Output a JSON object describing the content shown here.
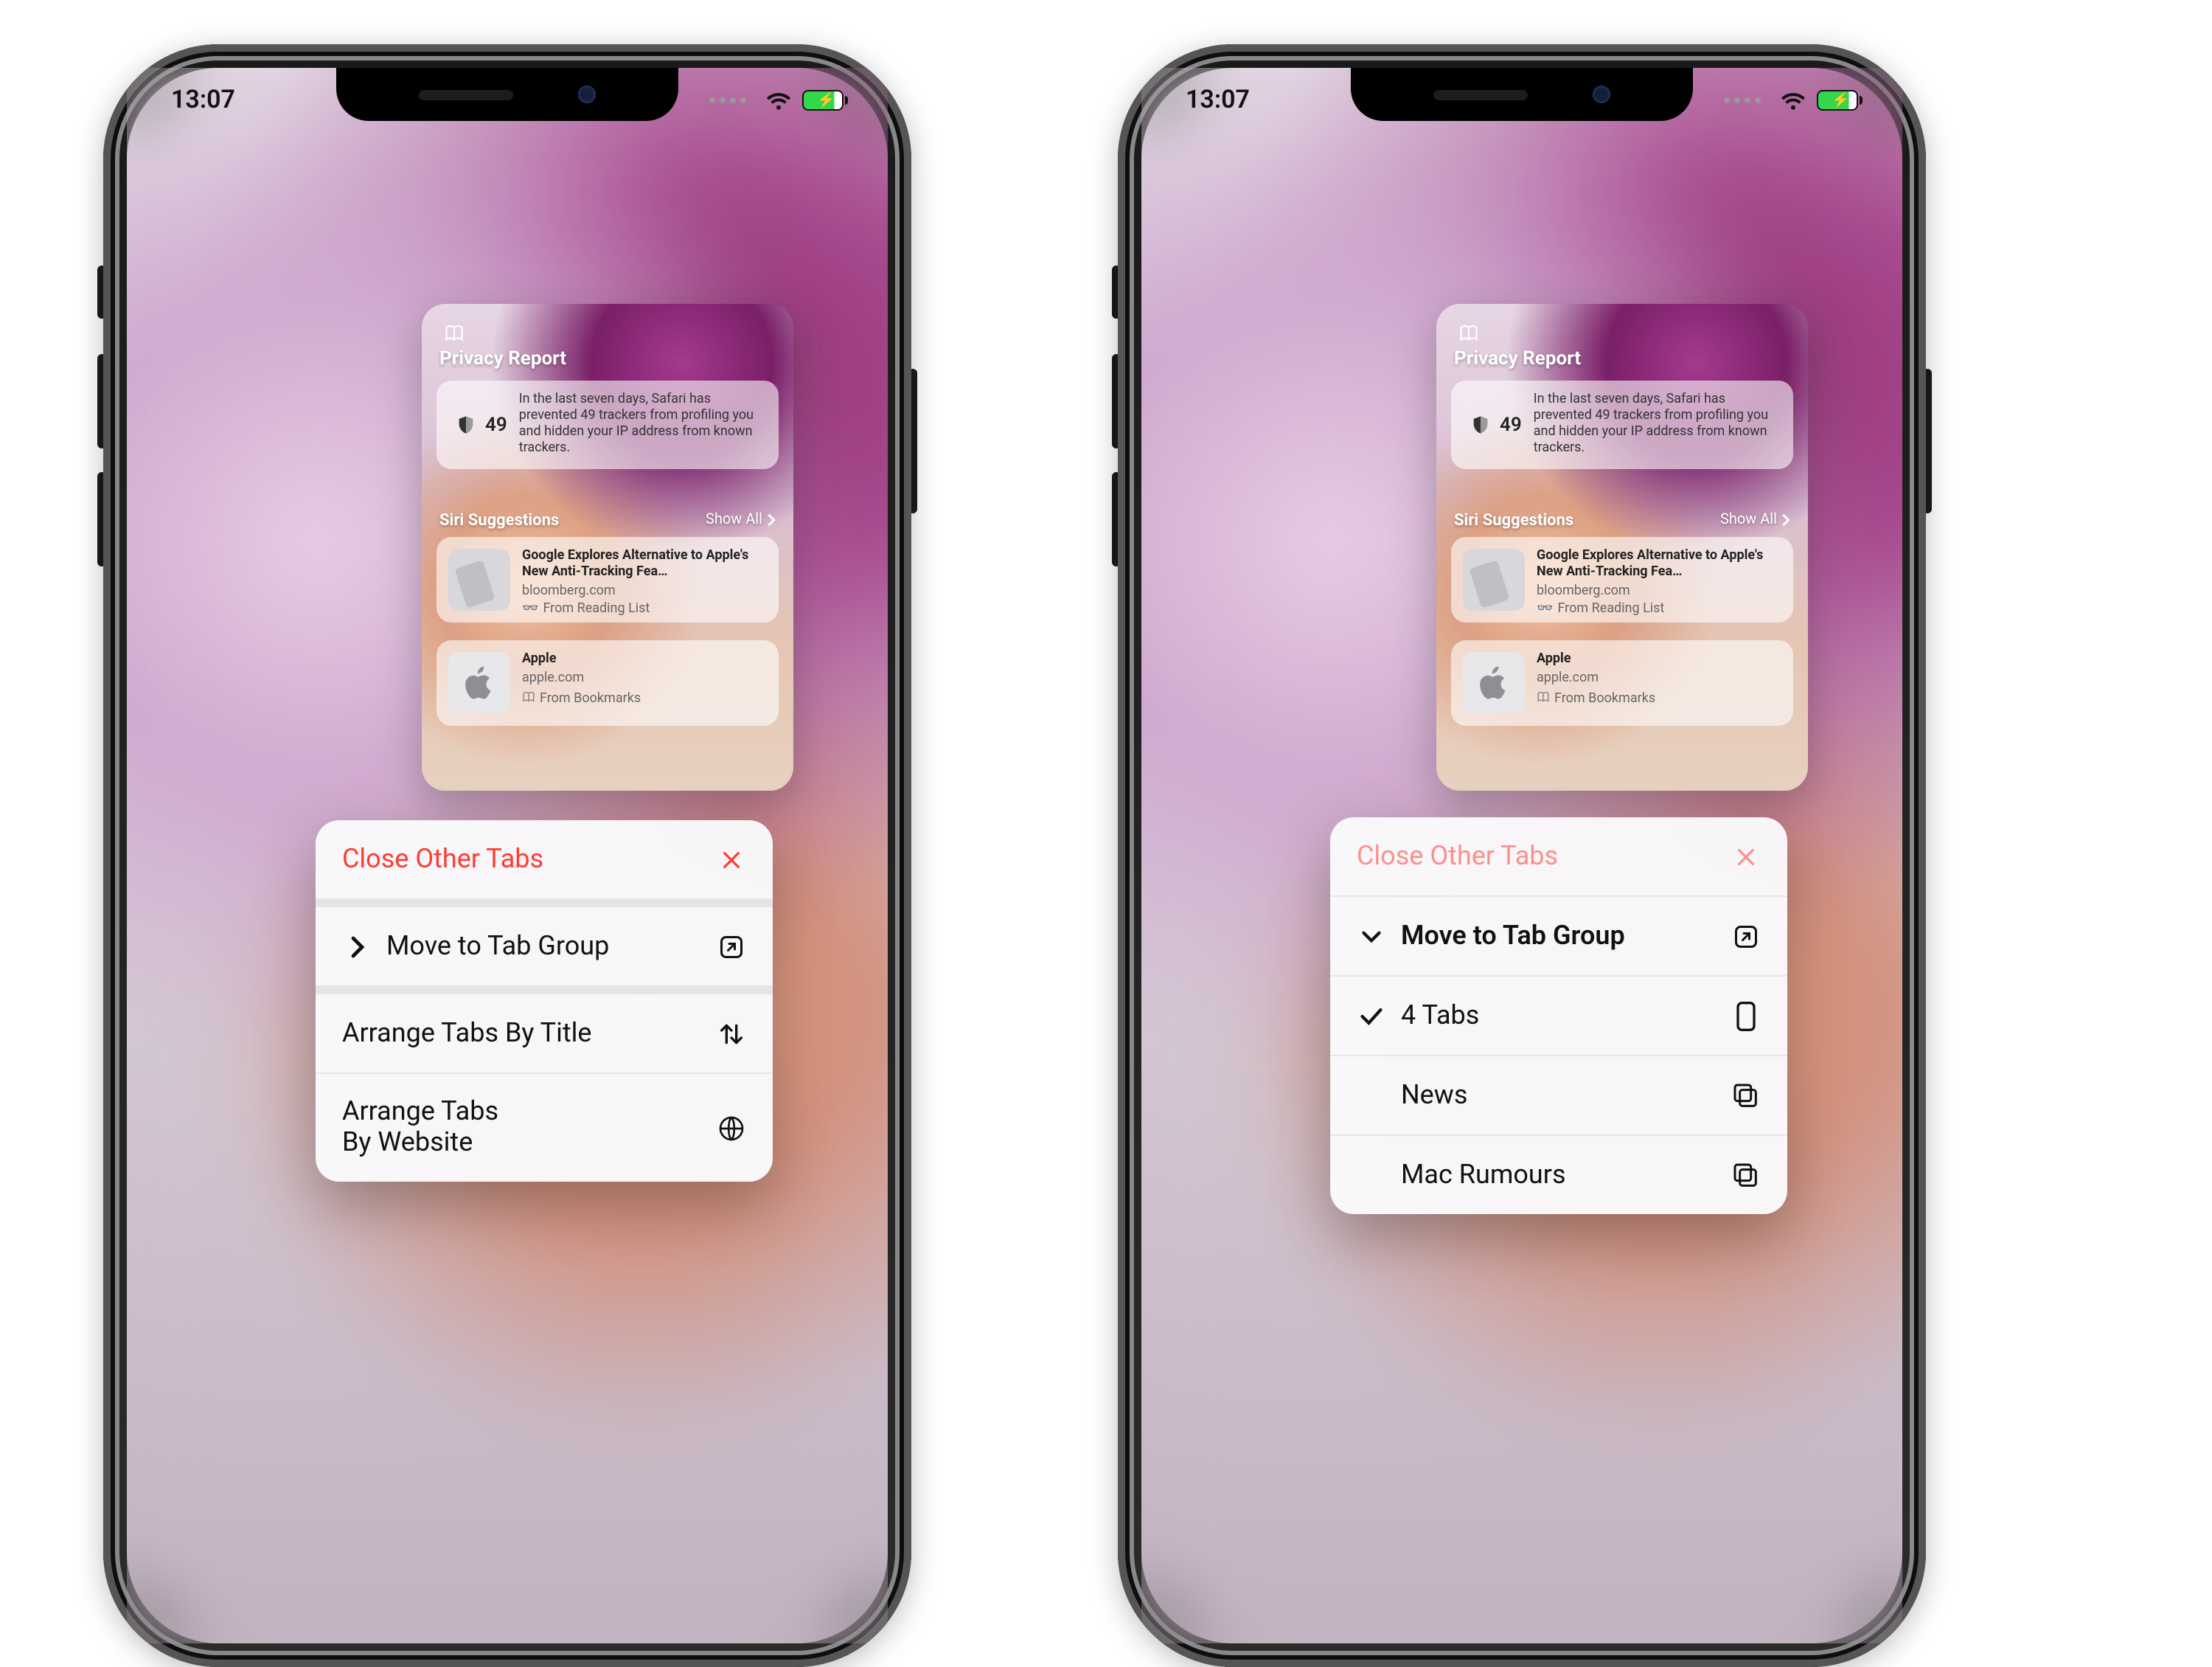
{
  "status": {
    "time": "13:07"
  },
  "preview": {
    "privacy_report": {
      "title": "Privacy Report",
      "count": "49",
      "text": "In the last seven days, Safari has prevented 49 trackers from profiling you and hidden your IP address from known trackers."
    },
    "siri": {
      "heading": "Siri Suggestions",
      "show_all": "Show All",
      "items": [
        {
          "title": "Google Explores Alternative to Apple's New Anti-Tracking Fea…",
          "subtitle": "bloomberg.com",
          "source": "From Reading List"
        },
        {
          "title": "Apple",
          "subtitle": "apple.com",
          "source": "From Bookmarks"
        }
      ]
    }
  },
  "menu_left": {
    "close_other": "Close Other Tabs",
    "move_group": "Move to Tab Group",
    "arrange_title": "Arrange Tabs By Title",
    "arrange_site_l1": "Arrange Tabs",
    "arrange_site_l2": "By Website"
  },
  "menu_right": {
    "close_other": "Close Other Tabs",
    "move_group": "Move to Tab Group",
    "groups": [
      {
        "label": "4 Tabs",
        "checked": true,
        "icon": "phone"
      },
      {
        "label": "News",
        "checked": false,
        "icon": "stack"
      },
      {
        "label": "Mac Rumours",
        "checked": false,
        "icon": "stack"
      }
    ]
  }
}
